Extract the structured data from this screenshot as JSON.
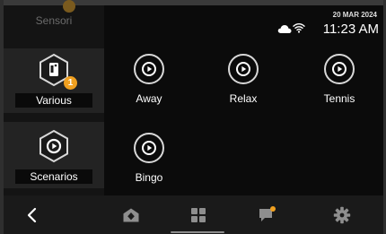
{
  "status": {
    "date": "20 MAR 2024",
    "time": "11:23 AM",
    "weather_icon": "cloud-icon",
    "wifi_icon": "wifi-icon"
  },
  "sidebar": {
    "items": [
      {
        "label": "Sensori",
        "icon": "sensor-icon",
        "selected": false
      },
      {
        "label": "Various",
        "icon": "device-icon",
        "badge": "1",
        "selected": true
      },
      {
        "label": "Scenarios",
        "icon": "play-icon",
        "selected": true
      }
    ]
  },
  "scenarios": [
    {
      "label": "Away",
      "icon": "play-icon"
    },
    {
      "label": "Relax",
      "icon": "play-icon"
    },
    {
      "label": "Tennis",
      "icon": "play-icon"
    },
    {
      "label": "Bingo",
      "icon": "play-icon"
    }
  ],
  "bottom_nav": [
    {
      "name": "back",
      "icon": "chevron-left-icon"
    },
    {
      "name": "home",
      "icon": "house-icon"
    },
    {
      "name": "apps",
      "icon": "grid-icon"
    },
    {
      "name": "messages",
      "icon": "chat-icon",
      "notification": true
    },
    {
      "name": "settings",
      "icon": "gear-icon"
    }
  ],
  "colors": {
    "accent": "#f0a020",
    "background": "#0b0b0b",
    "sidebar": "#141414",
    "bottombar": "#1a1a1a"
  }
}
